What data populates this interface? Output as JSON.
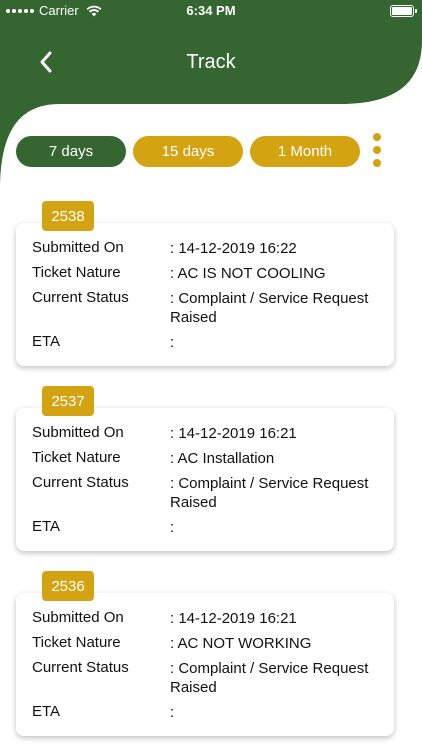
{
  "colors": {
    "header_green": "#356632",
    "accent_gold": "#d4a312",
    "card_bg": "#ffffff"
  },
  "status_bar": {
    "carrier": "Carrier",
    "time": "6:34 PM"
  },
  "nav": {
    "title": "Track",
    "back_icon": "chevron-left-icon"
  },
  "filters": {
    "items": [
      {
        "label": "7 days",
        "active": true
      },
      {
        "label": "15 days",
        "active": false
      },
      {
        "label": "1 Month",
        "active": false
      }
    ],
    "more_icon": "vertical-ellipsis-icon"
  },
  "labels": {
    "submitted_on": "Submitted On",
    "ticket_nature": "Ticket Nature",
    "current_status": "Current Status",
    "eta": "ETA"
  },
  "tickets": [
    {
      "id": "2538",
      "submitted_on": ": 14-12-2019 16:22",
      "ticket_nature": ": AC IS NOT COOLING",
      "current_status": ": Complaint / Service Request Raised",
      "eta": ":"
    },
    {
      "id": "2537",
      "submitted_on": ": 14-12-2019 16:21",
      "ticket_nature": ": AC Installation",
      "current_status": ": Complaint / Service Request Raised",
      "eta": ":"
    },
    {
      "id": "2536",
      "submitted_on": ": 14-12-2019 16:21",
      "ticket_nature": ": AC NOT WORKING",
      "current_status": ": Complaint / Service Request Raised",
      "eta": ":"
    }
  ]
}
